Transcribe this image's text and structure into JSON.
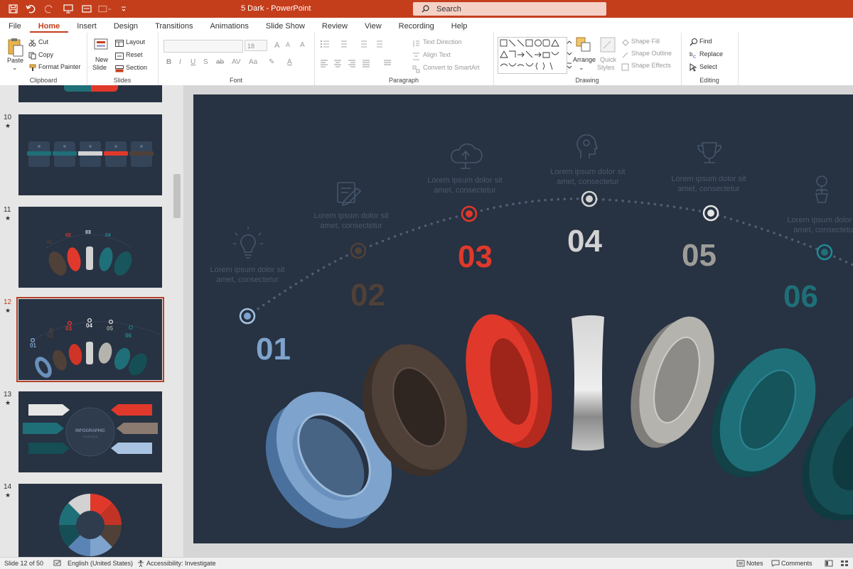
{
  "window": {
    "doc_title": "5 Dark  -  PowerPoint",
    "search_placeholder": "Search"
  },
  "tabs": [
    "File",
    "Home",
    "Insert",
    "Design",
    "Transitions",
    "Animations",
    "Slide Show",
    "Review",
    "View",
    "Recording",
    "Help"
  ],
  "active_tab": "Home",
  "ribbon": {
    "clipboard": {
      "paste": "Paste",
      "cut": "Cut",
      "copy": "Copy",
      "format_painter": "Format Painter",
      "label": "Clipboard"
    },
    "slides": {
      "new_slide_1": "New",
      "new_slide_2": "Slide",
      "layout": "Layout",
      "reset": "Reset",
      "section": "Section",
      "label": "Slides"
    },
    "font": {
      "size": "18",
      "label": "Font"
    },
    "paragraph": {
      "text_direction": "Text Direction",
      "align_text": "Align Text",
      "convert_smartart": "Convert to SmartArt",
      "label": "Paragraph"
    },
    "drawing": {
      "arrange": "Arrange",
      "quick_styles_1": "Quick",
      "quick_styles_2": "Styles",
      "shape_fill": "Shape Fill",
      "shape_outline": "Shape Outline",
      "shape_effects": "Shape Effects",
      "label": "Drawing"
    },
    "editing": {
      "find": "Find",
      "replace": "Replace",
      "select": "Select",
      "label": "Editing"
    }
  },
  "thumbnails": [
    {
      "number": "10",
      "star": "★"
    },
    {
      "number": "11",
      "star": "★"
    },
    {
      "number": "12",
      "star": "★"
    },
    {
      "number": "13",
      "star": "★"
    },
    {
      "number": "14",
      "star": "★"
    }
  ],
  "selected_slide": "12",
  "slide": {
    "items": [
      {
        "num": "01",
        "text1": "Lorem ipsum dolor sit",
        "text2": "amet, consectetur",
        "color": "#7ea3cc"
      },
      {
        "num": "02",
        "text1": "Lorem ipsum dolor sit",
        "text2": "amet, consectetur",
        "color": "#4f4038"
      },
      {
        "num": "03",
        "text1": "Lorem ipsum dolor sit",
        "text2": "amet, consectetur",
        "color": "#e0392b"
      },
      {
        "num": "04",
        "text1": "Lorem ipsum dolor sit",
        "text2": "amet, consectetur",
        "color": "#d2d2d2"
      },
      {
        "num": "05",
        "text1": "Lorem ipsum dolor sit",
        "text2": "amet, consectetur",
        "color": "#9e9c98"
      },
      {
        "num": "06",
        "text1": "Lorem ipsum dolor sit",
        "text2": "amet, consectetur",
        "color": "#1f6f78"
      }
    ],
    "thumb_infographic_title": "INFOGRAPHIC",
    "thumb_infographic_sub": "TEMPLATE"
  },
  "status": {
    "slide_info": "Slide 12 of 50",
    "language": "English (United States)",
    "accessibility": "Accessibility: Investigate",
    "notes": "Notes",
    "comments": "Comments"
  },
  "colors": {
    "accent": "#c43e1c",
    "slide_bg": "#273242"
  }
}
